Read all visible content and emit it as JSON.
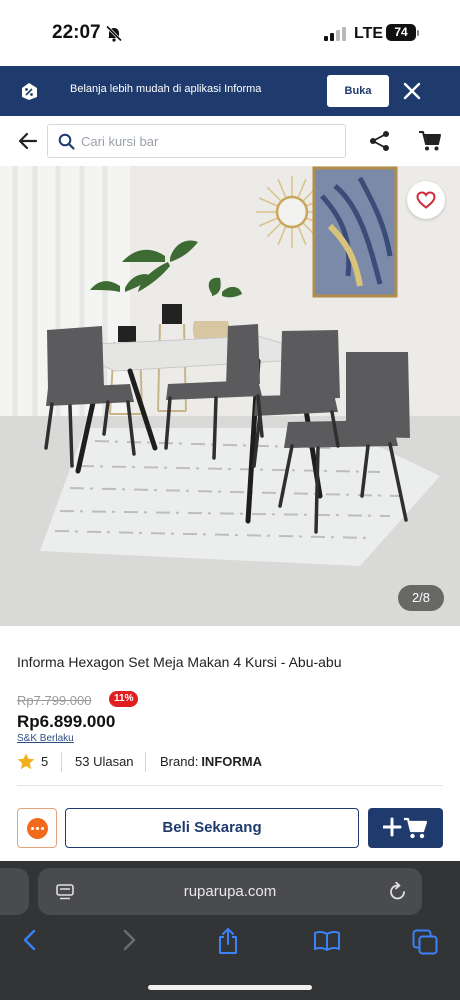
{
  "status_bar": {
    "time": "22:07",
    "network": "LTE",
    "battery": "74"
  },
  "app_banner": {
    "message": "Belanja lebih mudah di aplikasi Informa",
    "open_label": "Buka"
  },
  "search": {
    "placeholder": "Cari kursi bar"
  },
  "gallery": {
    "counter": "2/8"
  },
  "product": {
    "title": "Informa Hexagon Set Meja Makan 4 Kursi - Abu-abu",
    "original_price": "Rp7.799.000",
    "discount": "11%",
    "price": "Rp6.899.000",
    "terms": "S&K Berlaku",
    "rating": "5",
    "reviews": "53 Ulasan",
    "brand_label": "Brand:",
    "brand_value": "INFORMA"
  },
  "actions": {
    "buy_now": "Beli Sekarang"
  },
  "browser": {
    "url": "ruparupa.com"
  },
  "colors": {
    "brand_navy": "#1f3b6e",
    "discount_red": "#e02020",
    "chat_orange": "#f26a1b",
    "star_gold": "#f2b01e"
  },
  "icons": [
    "bell-off-icon",
    "app-logo-icon",
    "close-icon",
    "back-arrow-icon",
    "search-icon",
    "share-icon",
    "cart-icon",
    "heart-icon",
    "star-icon",
    "chat-icon",
    "add-cart-icon",
    "page-icon",
    "reload-icon",
    "chevron-left-icon",
    "chevron-right-icon",
    "share-box-icon",
    "book-icon",
    "tabs-icon"
  ]
}
